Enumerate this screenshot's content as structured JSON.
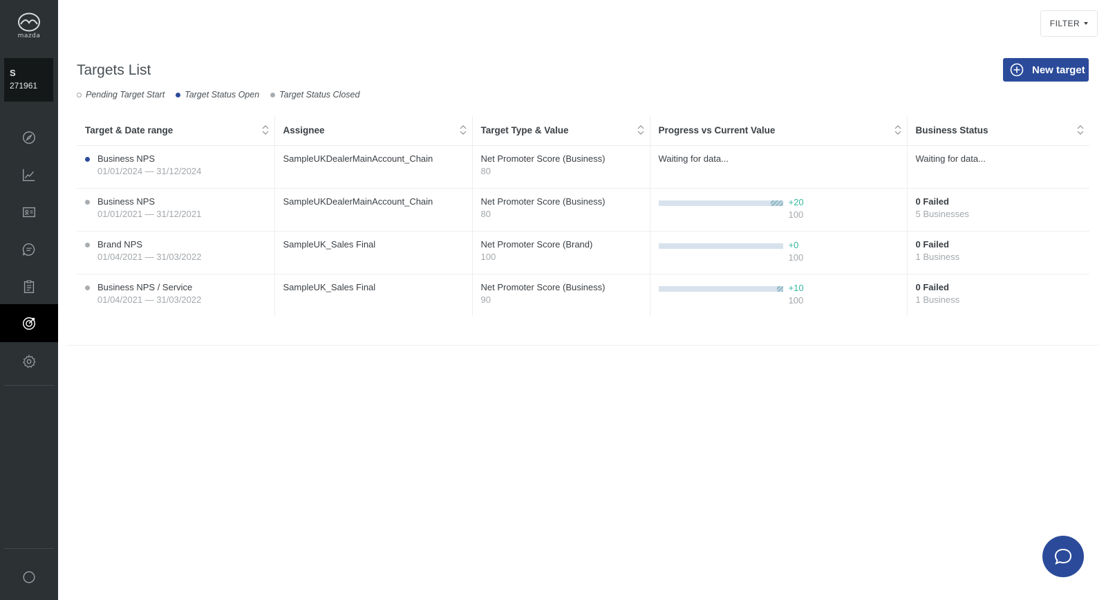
{
  "brand": {
    "logo_text": "mazda"
  },
  "account": {
    "initial": "S",
    "number": "271961"
  },
  "nav": {
    "items": [
      {
        "icon": "compass-icon"
      },
      {
        "icon": "line-chart-icon"
      },
      {
        "icon": "contact-card-icon"
      },
      {
        "icon": "chat-bubble-icon"
      },
      {
        "icon": "clipboard-icon"
      },
      {
        "icon": "target-icon",
        "active": true
      },
      {
        "icon": "settings-icon"
      }
    ],
    "bottom_icon": "user-circle-icon"
  },
  "toolbar": {
    "filter_label": "FILTER"
  },
  "page": {
    "title": "Targets List",
    "new_target_label": "New target"
  },
  "legend": [
    {
      "label": "Pending Target Start",
      "status": "pending"
    },
    {
      "label": "Target Status Open",
      "status": "open"
    },
    {
      "label": "Target Status Closed",
      "status": "closed"
    }
  ],
  "table": {
    "columns": [
      "Target & Date range",
      "Assignee",
      "Target Type & Value",
      "Progress vs Current Value",
      "Business Status"
    ],
    "rows": [
      {
        "status": "open",
        "name": "Business NPS",
        "dates": "01/01/2024 — 31/12/2024",
        "assignee": "SampleUKDealerMainAccount_Chain",
        "type": "Net Promoter Score (Business)",
        "value": "80",
        "progress_text": "Waiting for data...",
        "business_status": "Waiting for data..."
      },
      {
        "status": "closed",
        "name": "Business NPS",
        "dates": "01/01/2021 — 31/12/2021",
        "assignee": "SampleUKDealerMainAccount_Chain",
        "type": "Net Promoter Score (Business)",
        "value": "80",
        "progress": {
          "delta": "+20",
          "target": "100",
          "fill": 0.9,
          "hatch_from": 0.9,
          "hatch_to": 1.0
        },
        "business_status": "0 Failed",
        "business_sub": "5 Businesses"
      },
      {
        "status": "closed",
        "name": "Brand NPS",
        "dates": "01/04/2021 — 31/03/2022",
        "assignee": "SampleUK_Sales Final",
        "type": "Net Promoter Score (Brand)",
        "value": "100",
        "progress": {
          "delta": "+0",
          "target": "100",
          "fill": 1.0,
          "hatch_from": 1.0,
          "hatch_to": 1.0
        },
        "business_status": "0 Failed",
        "business_sub": "1 Business"
      },
      {
        "status": "closed",
        "name": "Business NPS / Service",
        "dates": "01/04/2021 — 31/03/2022",
        "assignee": "SampleUK_Sales Final",
        "type": "Net Promoter Score (Business)",
        "value": "90",
        "progress": {
          "delta": "+10",
          "target": "100",
          "fill": 0.95,
          "hatch_from": 0.95,
          "hatch_to": 1.0
        },
        "business_status": "0 Failed",
        "business_sub": "1 Business"
      }
    ]
  },
  "support": {
    "icon": "chat-support-icon"
  }
}
